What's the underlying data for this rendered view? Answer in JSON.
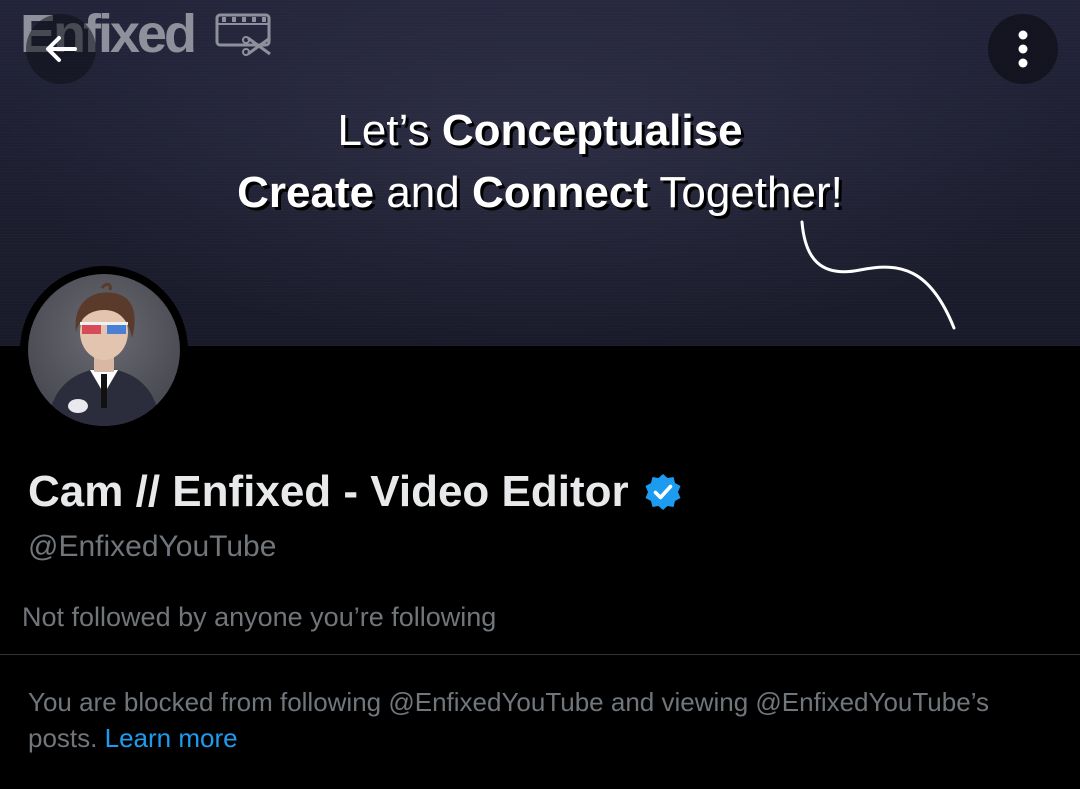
{
  "banner": {
    "brand_text": "Enfixed",
    "tagline": {
      "line1": [
        {
          "text": "Let’s ",
          "bold": false
        },
        {
          "text": "Conceptualise",
          "bold": true
        }
      ],
      "line2": [
        {
          "text": "Create",
          "bold": true
        },
        {
          "text": " and ",
          "bold": false
        },
        {
          "text": "Connect",
          "bold": true
        },
        {
          "text": " Together!",
          "bold": false
        }
      ]
    }
  },
  "profile": {
    "display_name": "Cam // Enfixed - Video Editor",
    "handle": "@EnfixedYouTube",
    "followed_note": "Not followed by anyone you’re following",
    "verified": true
  },
  "notice": {
    "text": "You are blocked from following @EnfixedYouTube and viewing @EnfixedYouTube’s posts.",
    "link_label": "Learn more"
  },
  "icons": {
    "back": "arrow-left-icon",
    "more": "more-vertical-icon",
    "verified": "verified-badge-icon",
    "brand": "film-scissors-icon"
  },
  "colors": {
    "background": "#000000",
    "primary_text": "#e7e9ea",
    "secondary_text": "#71767b",
    "link": "#1d9bf0",
    "verified": "#1d9bf0"
  }
}
